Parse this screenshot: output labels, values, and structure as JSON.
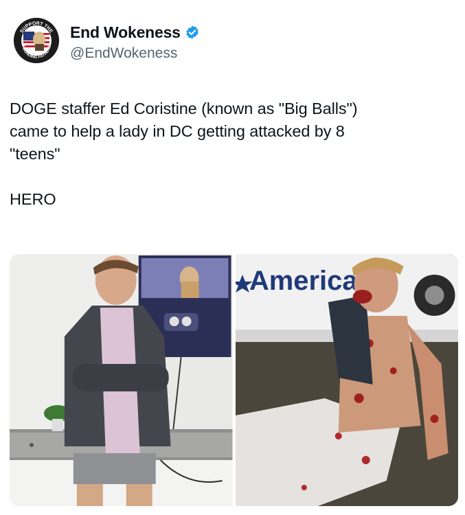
{
  "author": {
    "display_name": "End Wokeness",
    "handle": "@EndWokeness",
    "verified": true,
    "avatar_icon": "support-the-founding-fathers-badge-icon",
    "avatar_text_top": "SUPPORT THE",
    "avatar_text_bottom": "FOUNDING FATHERS"
  },
  "tweet": {
    "lines": [
      "DOGE staffer Ed Coristine (known as \"Big Balls\")",
      "came to help a lady in DC getting attacked by 8",
      "\"teens\""
    ],
    "closing": "HERO"
  },
  "media": {
    "photo_left_icon": "young-man-in-blazer-photo",
    "photo_right_icon": "injured-man-sitting-by-van-photo",
    "van_sign_text": "American"
  },
  "colors": {
    "verified_blue": "#1d9bf0",
    "handle_gray": "#536471",
    "text": "#0f1419"
  }
}
